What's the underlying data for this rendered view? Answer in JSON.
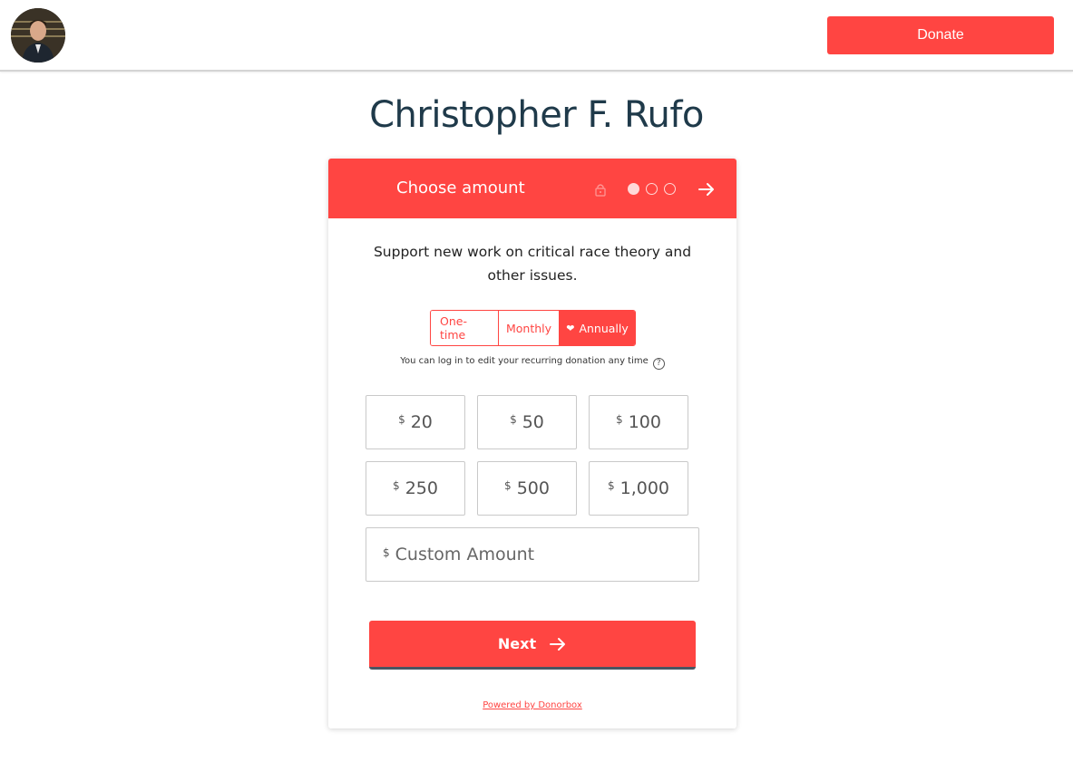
{
  "header": {
    "donate_label": "Donate",
    "avatar_icon": "profile-photo"
  },
  "page": {
    "title": "Christopher F. Rufo"
  },
  "form": {
    "step_title": "Choose amount",
    "steps_total": 3,
    "steps_current": 1,
    "description": "Support new work on critical race theory and other issues.",
    "frequency": {
      "options": [
        "One-time",
        "Monthly",
        "Annually"
      ],
      "selected": "Annually"
    },
    "recurring_note": "You can log in to edit your recurring donation any time",
    "currency_symbol": "$",
    "amounts": [
      "20",
      "50",
      "100",
      "250",
      "500",
      "1,000"
    ],
    "custom_placeholder": "Custom Amount",
    "next_label": "Next",
    "powered_by": "Powered by Donorbox"
  },
  "colors": {
    "accent": "#ff4542",
    "title": "#1f3a4a"
  }
}
